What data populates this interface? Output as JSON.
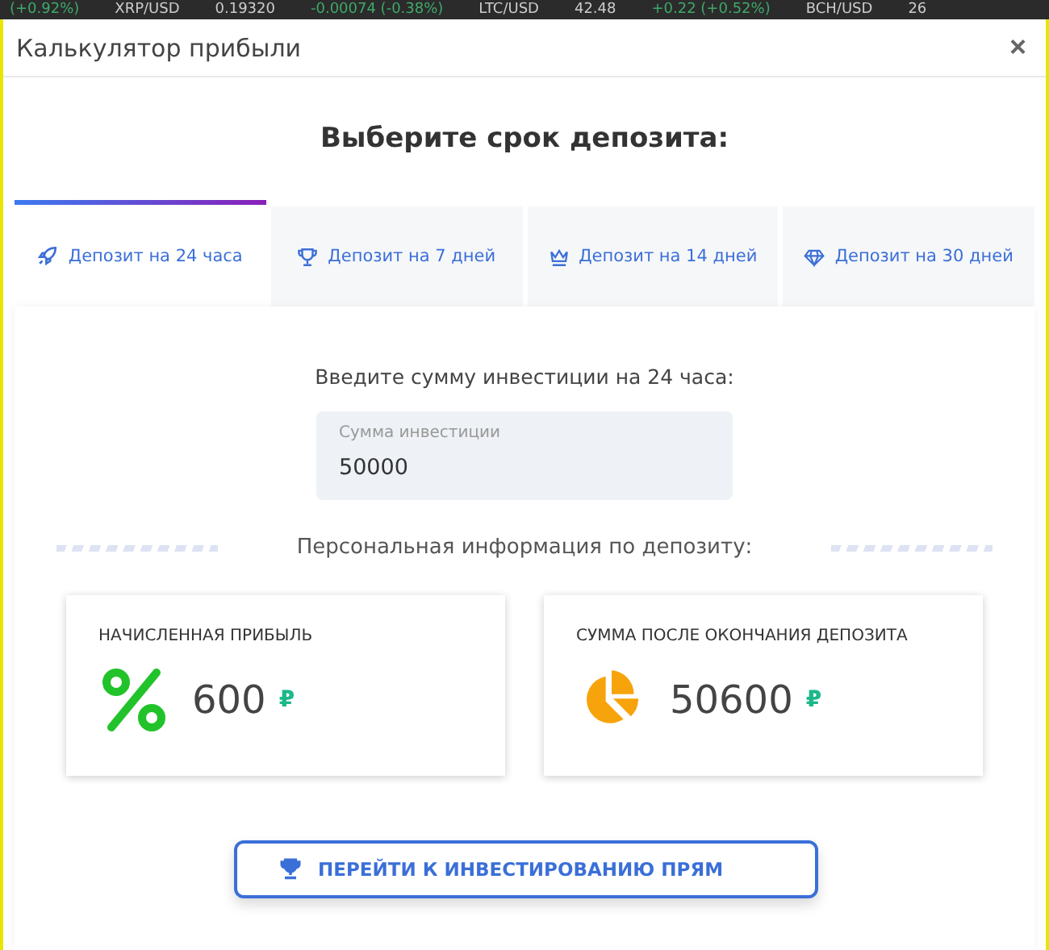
{
  "ticker": [
    {
      "text": "(+0.92%)",
      "color": "#3fa86b"
    },
    {
      "text": "XRP/USD",
      "color": "#cccccc"
    },
    {
      "text": "0.19320",
      "color": "#cccccc"
    },
    {
      "text": "-0.00074 (-0.38%)",
      "color": "#3fa86b"
    },
    {
      "text": "LTC/USD",
      "color": "#cccccc"
    },
    {
      "text": "42.48",
      "color": "#cccccc"
    },
    {
      "text": "+0.22 (+0.52%)",
      "color": "#3fa86b"
    },
    {
      "text": "BCH/USD",
      "color": "#cccccc"
    },
    {
      "text": "26",
      "color": "#cccccc"
    }
  ],
  "window": {
    "title": "Калькулятор прибыли",
    "close": "×"
  },
  "heading": "Выберите срок депозита:",
  "tabs": [
    {
      "label": "Депозит на 24 часа",
      "kind": "rocket",
      "selected": true
    },
    {
      "label": "Депозит на 7 дней",
      "kind": "trophy",
      "selected": false
    },
    {
      "label": "Депозит на 14 дней",
      "kind": "crown",
      "selected": false
    },
    {
      "label": "Депозит на 30 дней",
      "kind": "diamond",
      "selected": false
    }
  ],
  "prompt": "Введите сумму инвестиции на 24 часа:",
  "amount_field": {
    "label": "Сумма инвестиции",
    "value": "50000"
  },
  "section_title": "Персональная информация по депозиту:",
  "cards": [
    {
      "title": "НАЧИСЛЕННАЯ ПРИБЫЛЬ",
      "kind": "percent",
      "value": "600",
      "currency": "₽"
    },
    {
      "title": "СУММА ПОСЛЕ ОКОНЧАНИЯ ДЕПОЗИТА",
      "kind": "pie",
      "value": "50600",
      "currency": "₽"
    }
  ],
  "invest_button": {
    "label": "ПЕРЕЙТИ К ИНВЕСТИРОВАНИЮ ПРЯМ"
  }
}
